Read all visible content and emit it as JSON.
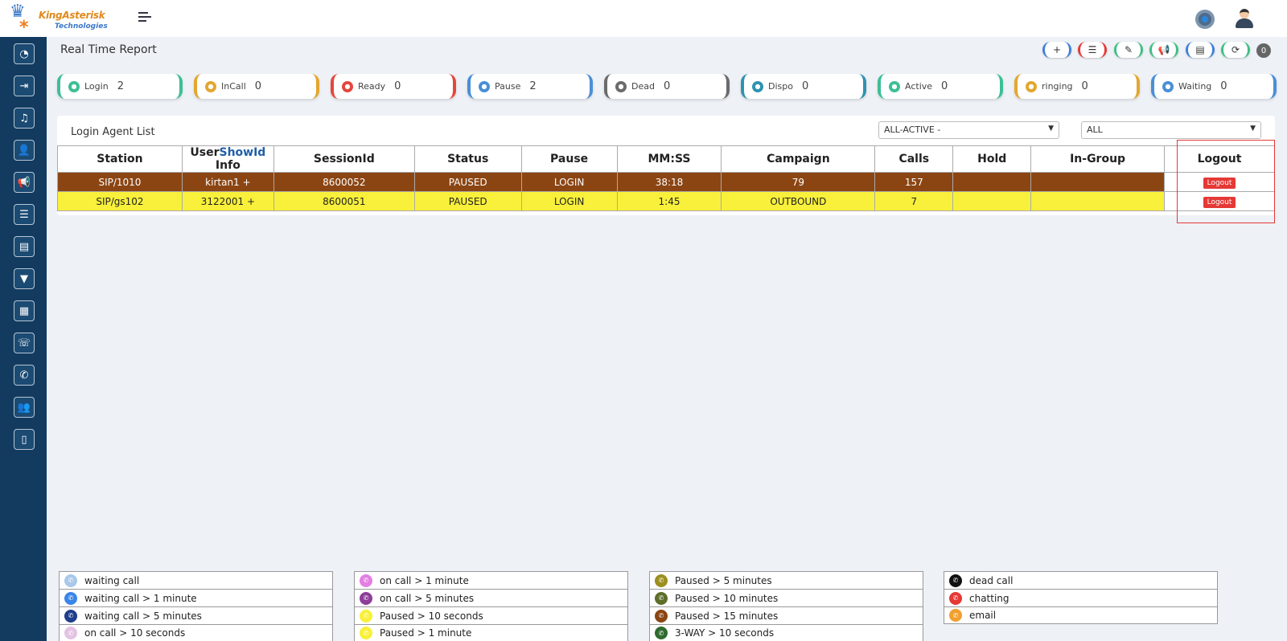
{
  "brand": {
    "name": "KingAsterisk",
    "sub": "Technologies"
  },
  "page_title": "Real Time Report",
  "actions": [
    {
      "icon": "plus-icon",
      "glyph": "+",
      "color": "#3f7fd9"
    },
    {
      "icon": "list-icon",
      "glyph": "☰",
      "color": "#e53935"
    },
    {
      "icon": "edit-icon",
      "glyph": "✎",
      "color": "#3dbf83"
    },
    {
      "icon": "megaphone-icon",
      "glyph": "📢",
      "color": "#3dbf83"
    },
    {
      "icon": "report-icon",
      "glyph": "▤",
      "color": "#3f7fd9"
    },
    {
      "icon": "refresh-icon",
      "glyph": "⟳",
      "color": "#3dbf83"
    }
  ],
  "action_count": "0",
  "cards": [
    {
      "label": "Login",
      "value": "2",
      "color": "#3dbf96"
    },
    {
      "label": "InCall",
      "value": "0",
      "color": "#e3a72f"
    },
    {
      "label": "Ready",
      "value": "0",
      "color": "#e5473b"
    },
    {
      "label": "Pause",
      "value": "2",
      "color": "#4a8fd6"
    },
    {
      "label": "Dead",
      "value": "0",
      "color": "#6b6b6b"
    },
    {
      "label": "Dispo",
      "value": "0",
      "color": "#2f93b0"
    },
    {
      "label": "Active",
      "value": "0",
      "color": "#3dbf96"
    },
    {
      "label": "ringing",
      "value": "0",
      "color": "#e3a72f"
    },
    {
      "label": "Waiting",
      "value": "0",
      "color": "#4a8fd6"
    }
  ],
  "panel": {
    "title": "Login Agent List",
    "filter_group": "ALL-ACTIVE -",
    "filter_user": "ALL"
  },
  "table": {
    "headers": {
      "station": "Station",
      "user_pre": "User",
      "user_mid": "ShowId",
      "user_post": " Info",
      "session": "SessionId",
      "status": "Status",
      "pause": "Pause",
      "mmss": "MM:SS",
      "campaign": "Campaign",
      "calls": "Calls",
      "hold": "Hold",
      "ingroup": "In-Group",
      "logout": "Logout"
    },
    "rows": [
      {
        "station": "SIP/1010",
        "user": "kirtan1 +",
        "session": "8600052",
        "status": "PAUSED",
        "pause": "LOGIN",
        "mmss": "38:18",
        "campaign": "79",
        "calls": "157",
        "hold": "",
        "ingroup": "",
        "logout": "Logout"
      },
      {
        "station": "SIP/gs102",
        "user": "3122001 +",
        "session": "8600051",
        "status": "PAUSED",
        "pause": "LOGIN",
        "mmss": "1:45",
        "campaign": "OUTBOUND",
        "calls": "7",
        "hold": "",
        "ingroup": "",
        "logout": "Logout"
      }
    ]
  },
  "legend": [
    [
      {
        "label": "waiting call",
        "color": "#a9c8ea"
      },
      {
        "label": "waiting call > 1 minute",
        "color": "#3a86e8"
      },
      {
        "label": "waiting call > 5 minutes",
        "color": "#1f3e8c"
      },
      {
        "label": "on call > 10 seconds",
        "color": "#e3c3e3"
      }
    ],
    [
      {
        "label": "on call > 1 minute",
        "color": "#e37fe3"
      },
      {
        "label": "on call > 5 minutes",
        "color": "#8e3f9a"
      },
      {
        "label": "Paused > 10 seconds",
        "color": "#f8f03a"
      },
      {
        "label": "Paused > 1 minute",
        "color": "#f8f03a"
      }
    ],
    [
      {
        "label": "Paused > 5 minutes",
        "color": "#9c8f1e"
      },
      {
        "label": "Paused > 10 minutes",
        "color": "#5d6e2a"
      },
      {
        "label": "Paused > 15 minutes",
        "color": "#8b4513"
      },
      {
        "label": "3-WAY > 10 seconds",
        "color": "#2f6b2f"
      }
    ],
    [
      {
        "label": "dead call",
        "color": "#111111"
      },
      {
        "label": "chatting",
        "color": "#e53935"
      },
      {
        "label": "email",
        "color": "#f0a030"
      }
    ]
  ]
}
